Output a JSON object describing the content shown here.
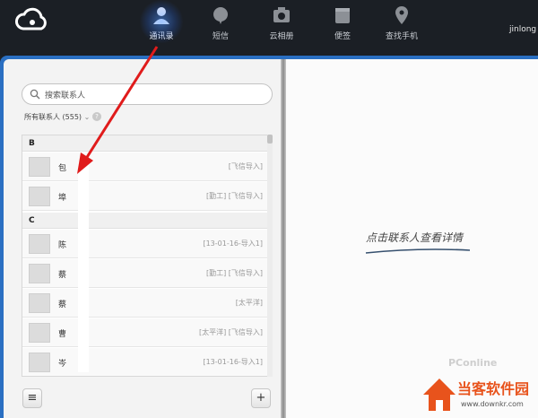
{
  "nav": {
    "items": [
      {
        "label": "通讯录",
        "icon": "contacts-icon",
        "active": true
      },
      {
        "label": "短信",
        "icon": "sms-icon",
        "active": false
      },
      {
        "label": "云相册",
        "icon": "camera-icon",
        "active": false
      },
      {
        "label": "便签",
        "icon": "note-icon",
        "active": false
      },
      {
        "label": "查找手机",
        "icon": "location-pin-icon",
        "active": false
      }
    ],
    "username": "jinlong"
  },
  "search": {
    "placeholder": "搜索联系人"
  },
  "contacts_filter": {
    "label": "所有联系人 (555)",
    "caret": "⌄",
    "help": "?"
  },
  "sections": [
    {
      "letter": "B",
      "rows": [
        {
          "name": "包",
          "tags": "[飞信导入]"
        },
        {
          "name": "埠",
          "tags": "[勤工]  [飞信导入]"
        }
      ]
    },
    {
      "letter": "C",
      "rows": [
        {
          "name": "陈",
          "tags": "[13-01-16-导入1]"
        },
        {
          "name": "蔡",
          "tags": "[勤工]  [飞信导入]"
        },
        {
          "name": "蔡",
          "tags": "[太平洋]"
        },
        {
          "name": "曹",
          "tags": "[太平洋]  [飞信导入]"
        },
        {
          "name": "岑",
          "tags": "[13-01-16-导入1]"
        }
      ]
    }
  ],
  "footer": {
    "menu_symbol": "≡",
    "add_symbol": "+"
  },
  "hint": "点击联系人查看详情",
  "watermark": {
    "title": "当客软件园",
    "url": "www.downkr.com",
    "faint": "PConline"
  },
  "colors": {
    "accent": "#2a6fc2",
    "arrow": "#e01b1b",
    "topbar": "#1b1f25"
  }
}
